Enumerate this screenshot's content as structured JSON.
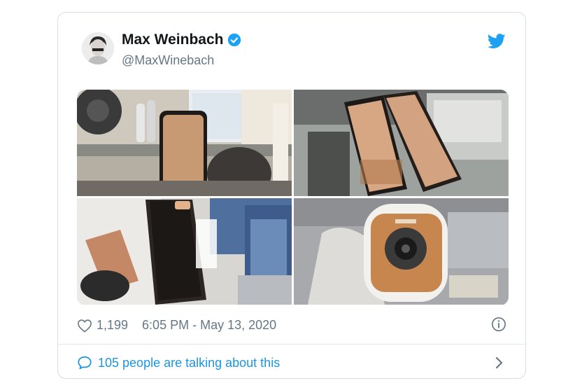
{
  "tweet": {
    "display_name": "Max Weinbach",
    "handle": "@MaxWinebach",
    "verified": true,
    "avatar_icon": "user-avatar",
    "brand_icon": "twitter-bird-icon",
    "brand_color": "#1da1f2",
    "link_color": "#1b95e0",
    "photos": [
      {
        "description_icon": "photo-phone-on-desk"
      },
      {
        "description_icon": "photo-two-phones"
      },
      {
        "description_icon": "photo-foldable-phone"
      },
      {
        "description_icon": "photo-camera-module"
      }
    ],
    "likes": "1,199",
    "timestamp": "6:05 PM - May 13, 2020",
    "conversation": "105 people are talking about this"
  }
}
